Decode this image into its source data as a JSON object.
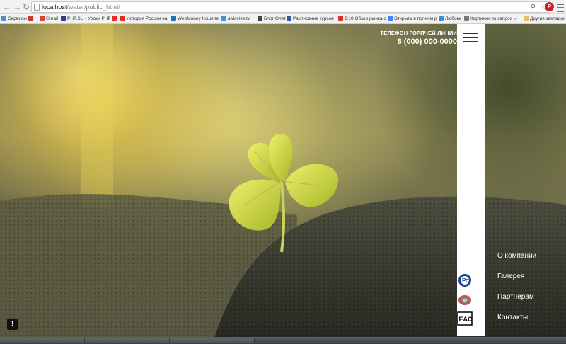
{
  "browser": {
    "url_host": "localhost",
    "url_path": "/water/public_html/",
    "bookmarks": [
      {
        "label": "Сервисы",
        "color": "#4a90d9"
      },
      {
        "label": "",
        "color": "#c33"
      },
      {
        "label": "Gmail",
        "color": "#d44638"
      },
      {
        "label": "PHP.SU - Уроки PHP",
        "color": "#2d3e8c"
      },
      {
        "label": "",
        "color": "#e52d27"
      },
      {
        "label": "История России на",
        "color": "#e52d27"
      },
      {
        "label": "WebMoney Кошелек",
        "color": "#1e6fbf"
      },
      {
        "label": "aMovies.tv",
        "color": "#3a9ad9"
      },
      {
        "label": "Блог Олятки",
        "color": "#444"
      },
      {
        "label": "Расписание курсов",
        "color": "#3b5998"
      },
      {
        "label": "2:10 Обзор рынка сп",
        "color": "#e52d27"
      },
      {
        "label": "Открыть в полном р",
        "color": "#4285f4"
      },
      {
        "label": "Любовь",
        "color": "#3b8ed6"
      },
      {
        "label": "Картинки по запрос",
        "color": "#777"
      },
      {
        "label": "»",
        "color": ""
      },
      {
        "label": "Другие закладки",
        "color": "#e8c15a"
      }
    ]
  },
  "header": {
    "hotline_label": "ТЕЛЕФОН ГОРЯЧЕЙ ЛИНИИ",
    "hotline_phone": "8 (000) 000-0000"
  },
  "nav": {
    "items": [
      "О компании",
      "Галерея",
      "Партнерам",
      "Контакты"
    ]
  },
  "certs": {
    "eac_text": "EAC"
  },
  "alert_label": "!"
}
